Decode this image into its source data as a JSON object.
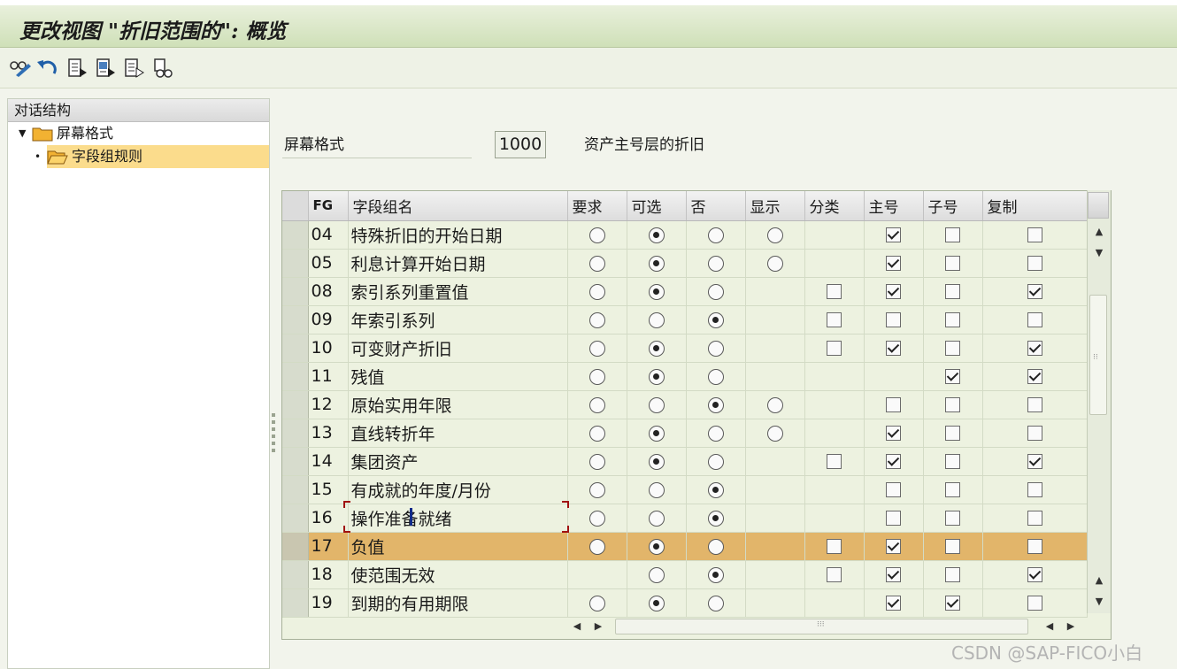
{
  "window": {
    "title": "更改视图 \"折旧范围的\": 概览"
  },
  "toolbar": {
    "buttons": [
      {
        "name": "display-change-icon"
      },
      {
        "name": "undo-icon"
      },
      {
        "name": "select-all-icon"
      },
      {
        "name": "select-block-icon"
      },
      {
        "name": "deselect-all-icon"
      },
      {
        "name": "print-icon"
      }
    ]
  },
  "dialog_structure": {
    "header": "对话结构",
    "items": [
      {
        "label": "屏幕格式",
        "expanded": true
      },
      {
        "label": "字段组规则",
        "selected": true
      }
    ]
  },
  "screen_layout": {
    "label": "屏幕格式",
    "value": "1000",
    "description": "资产主号层的折旧"
  },
  "table": {
    "columns": [
      "FG",
      "字段组名",
      "要求",
      "可选",
      "否",
      "显示",
      "分类",
      "主号",
      "子号",
      "复制"
    ],
    "rows": [
      {
        "fg": "04",
        "name": "特殊折旧的开始日期",
        "req": "off",
        "opt": "on",
        "no": "off",
        "disp": "off",
        "cls": "",
        "main": "on",
        "sub": "off",
        "copy": "off"
      },
      {
        "fg": "05",
        "name": "利息计算开始日期",
        "req": "off",
        "opt": "on",
        "no": "off",
        "disp": "off",
        "cls": "",
        "main": "on",
        "sub": "off",
        "copy": "off"
      },
      {
        "fg": "08",
        "name": "索引系列重置值",
        "req": "off",
        "opt": "on",
        "no": "off",
        "disp": "",
        "cls": "off",
        "main": "on",
        "sub": "off",
        "copy": "on"
      },
      {
        "fg": "09",
        "name": "年索引系列",
        "req": "off",
        "opt": "off",
        "no": "on",
        "disp": "",
        "cls": "off",
        "main": "off",
        "sub": "off",
        "copy": "off"
      },
      {
        "fg": "10",
        "name": "可变财产折旧",
        "req": "off",
        "opt": "on",
        "no": "off",
        "disp": "",
        "cls": "off",
        "main": "on",
        "sub": "off",
        "copy": "on"
      },
      {
        "fg": "11",
        "name": "残值",
        "req": "off",
        "opt": "on",
        "no": "off",
        "disp": "",
        "cls": "",
        "main": "",
        "sub": "on",
        "copy": "on"
      },
      {
        "fg": "12",
        "name": "原始实用年限",
        "req": "off",
        "opt": "off",
        "no": "on",
        "disp": "off",
        "cls": "",
        "main": "off",
        "sub": "off",
        "copy": "off"
      },
      {
        "fg": "13",
        "name": "直线转折年",
        "req": "off",
        "opt": "on",
        "no": "off",
        "disp": "off",
        "cls": "",
        "main": "on",
        "sub": "off",
        "copy": "off"
      },
      {
        "fg": "14",
        "name": "集团资产",
        "req": "off",
        "opt": "on",
        "no": "off",
        "disp": "",
        "cls": "off",
        "main": "on",
        "sub": "off",
        "copy": "on"
      },
      {
        "fg": "15",
        "name": "有成就的年度/月份",
        "req": "off",
        "opt": "off",
        "no": "on",
        "disp": "",
        "cls": "",
        "main": "off",
        "sub": "off",
        "copy": "off"
      },
      {
        "fg": "16",
        "name": "操作准备就绪",
        "req": "off",
        "opt": "off",
        "no": "on",
        "disp": "",
        "cls": "",
        "main": "off",
        "sub": "off",
        "copy": "off"
      },
      {
        "fg": "17",
        "name": "负值",
        "req": "off",
        "opt": "on",
        "no": "off",
        "disp": "",
        "cls": "off",
        "main": "on",
        "sub": "off",
        "copy": "off",
        "highlight": true
      },
      {
        "fg": "18",
        "name": "使范围无效",
        "req": "",
        "opt": "off",
        "no": "on",
        "disp": "",
        "cls": "off",
        "main": "on",
        "sub": "off",
        "copy": "on"
      },
      {
        "fg": "19",
        "name": "到期的有用期限",
        "req": "off",
        "opt": "on",
        "no": "off",
        "disp": "",
        "cls": "",
        "main": "on",
        "sub": "on",
        "copy": "off"
      }
    ]
  },
  "watermark": "CSDN @SAP-FICO小白"
}
